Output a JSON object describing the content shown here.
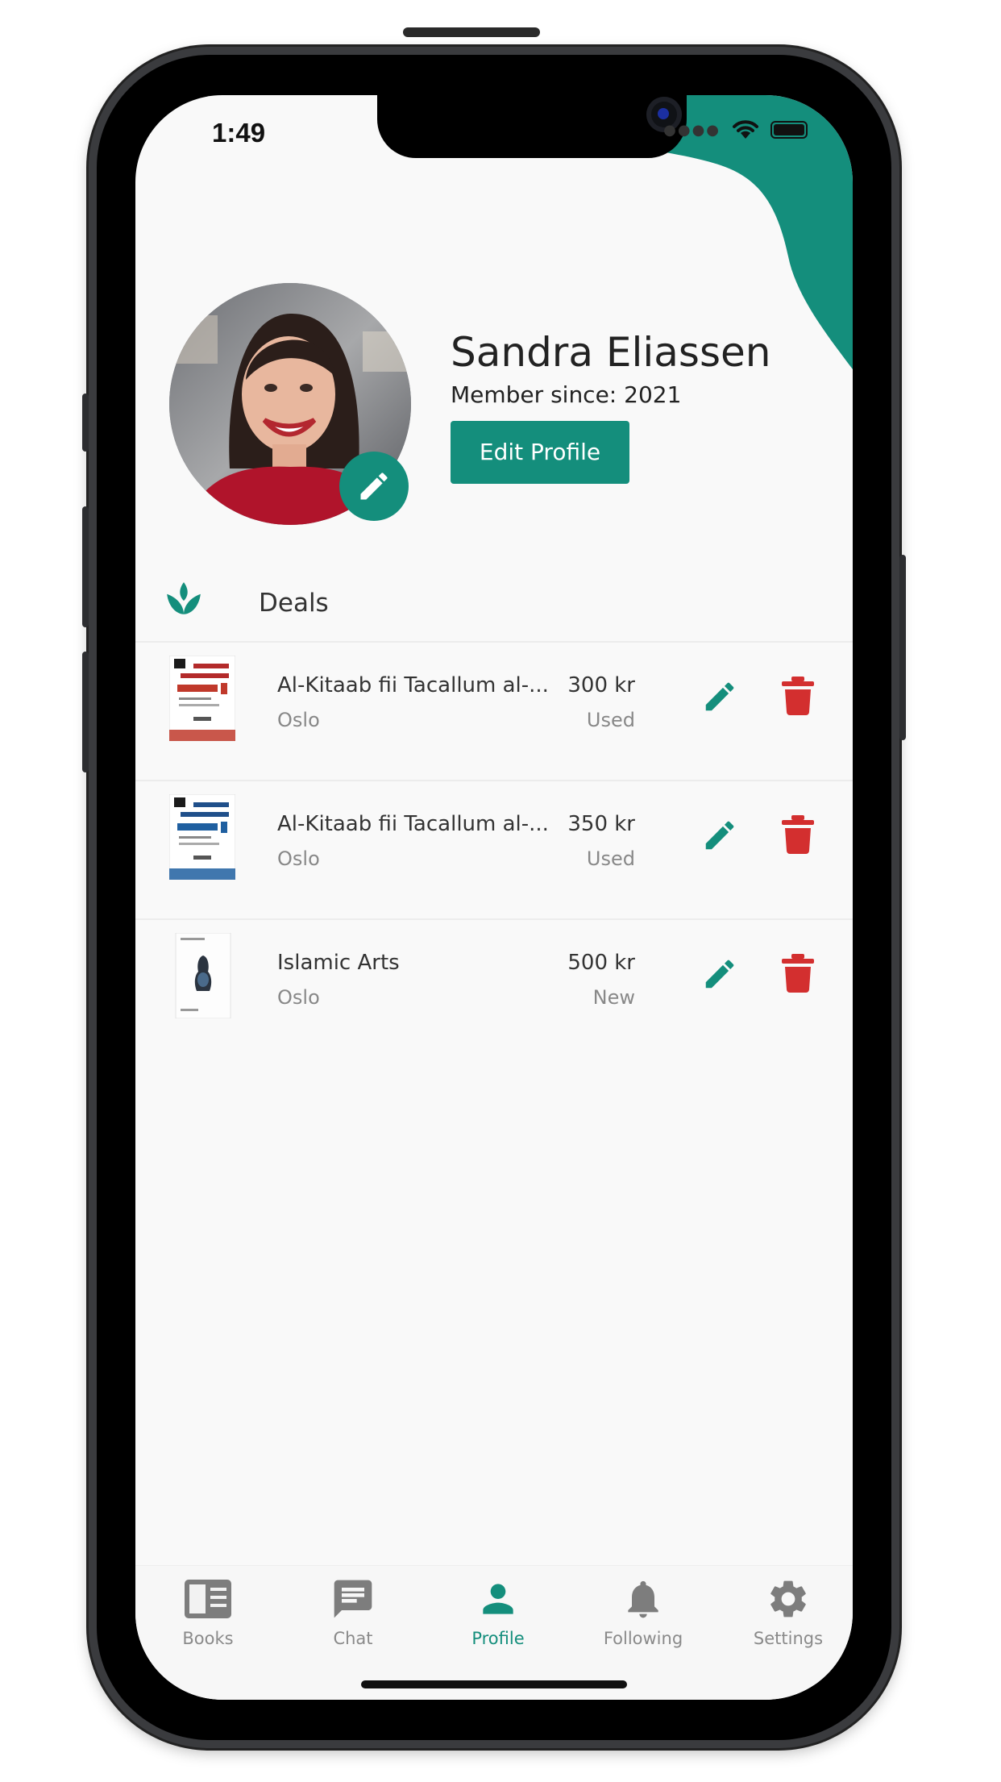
{
  "status_bar": {
    "time": "1:49"
  },
  "profile": {
    "name": "Sandra Eliassen",
    "member_since": "Member since: 2021",
    "edit_button": "Edit Profile"
  },
  "deals": {
    "header": "Deals",
    "items": [
      {
        "title": "Al-Kitaab fii Tacallum al-...",
        "city": "Oslo",
        "price": "300 kr",
        "condition": "Used"
      },
      {
        "title": "Al-Kitaab fii Tacallum al-...",
        "city": "Oslo",
        "price": "350 kr",
        "condition": "Used"
      },
      {
        "title": "Islamic Arts",
        "city": "Oslo",
        "price": "500 kr",
        "condition": "New"
      }
    ]
  },
  "tabs": [
    {
      "label": "Books",
      "icon": "book-icon"
    },
    {
      "label": "Chat",
      "icon": "chat-icon"
    },
    {
      "label": "Profile",
      "icon": "person-icon",
      "active": true
    },
    {
      "label": "Following",
      "icon": "bell-icon"
    },
    {
      "label": "Settings",
      "icon": "gear-icon"
    }
  ],
  "colors": {
    "accent": "#148e7c",
    "delete": "#d32f2f",
    "background": "#f9f9f9"
  }
}
